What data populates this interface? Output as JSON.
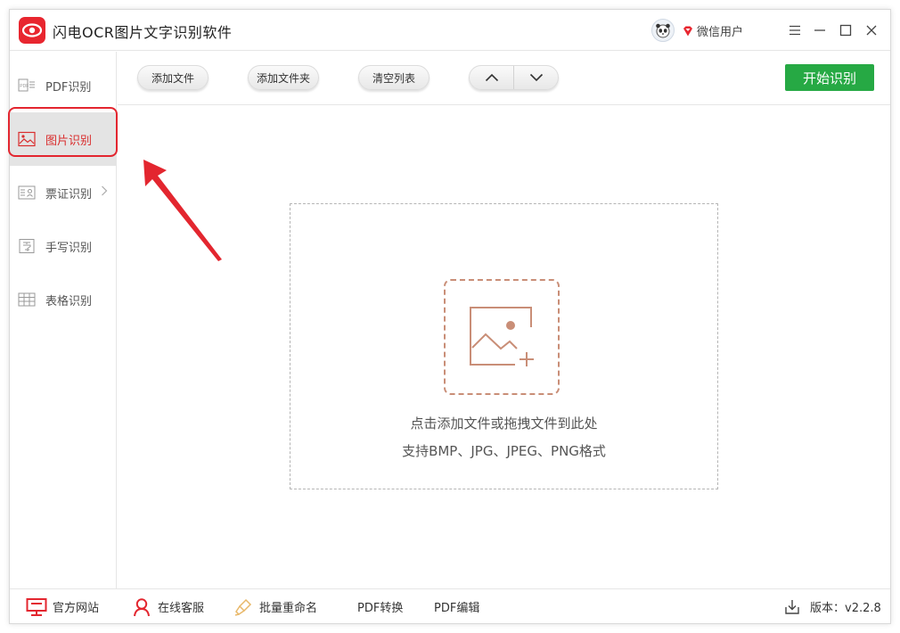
{
  "app": {
    "title": "闪电OCR图片文字识别软件",
    "accent_color": "#e8262f"
  },
  "user": {
    "name": "微信用户",
    "avatar_icon": "panda-avatar-icon",
    "badge_icon": "vip-diamond-icon"
  },
  "window_controls": {
    "menu_icon": "menu-icon",
    "min_icon": "minimize-icon",
    "max_icon": "maximize-icon",
    "close_icon": "close-icon"
  },
  "sidebar": {
    "items": [
      {
        "label": "PDF识别",
        "icon": "pdf-icon",
        "active": false
      },
      {
        "label": "图片识别",
        "icon": "image-icon",
        "active": true
      },
      {
        "label": "票证识别",
        "icon": "id-card-icon",
        "active": false,
        "has_submenu": true
      },
      {
        "label": "手写识别",
        "icon": "handwriting-icon",
        "active": false
      },
      {
        "label": "表格识别",
        "icon": "table-icon",
        "active": false
      }
    ],
    "active_color": "#d92d2d"
  },
  "toolbar": {
    "add_file": "添加文件",
    "add_folder": "添加文件夹",
    "clear_list": "清空列表",
    "move_up_icon": "chevron-up-icon",
    "move_down_icon": "chevron-down-icon",
    "start": "开始识别",
    "start_color": "#26a944"
  },
  "dropzone": {
    "hint": "点击添加文件或拖拽文件到此处",
    "formats": "支持BMP、JPG、JPEG、PNG格式",
    "icon": "add-image-icon"
  },
  "footer": {
    "website": "官方网站",
    "service": "在线客服",
    "rename": "批量重命名",
    "pdf_convert": "PDF转换",
    "pdf_edit": "PDF编辑",
    "version": "版本：v2.2.8"
  }
}
